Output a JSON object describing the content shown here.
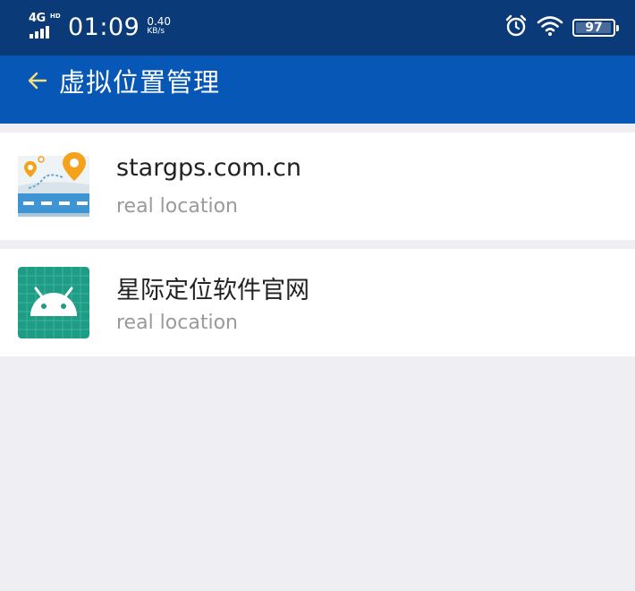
{
  "status_bar": {
    "network": "4G",
    "network_badge": "HD",
    "time": "01:09",
    "speed_value": "0.40",
    "speed_unit": "KB/s",
    "battery_percent": "97",
    "battery_level": 0.97,
    "icons": [
      "alarm-icon",
      "wifi-icon",
      "battery-icon"
    ]
  },
  "app_bar": {
    "back_icon": "arrow-left-icon",
    "title": "虚拟位置管理"
  },
  "list": {
    "items": [
      {
        "title": "stargps.com.cn",
        "subtitle": "real location",
        "icon": "map-location-app-icon"
      },
      {
        "title": "星际定位软件官网",
        "subtitle": "real location",
        "icon": "android-app-icon"
      }
    ]
  },
  "colors": {
    "status_bar_bg": "#0a3a78",
    "app_bar_bg": "#0758b6",
    "back_arrow": "#f6e07a",
    "page_bg": "#eeeef3",
    "android_tile": "#1f9c86"
  }
}
